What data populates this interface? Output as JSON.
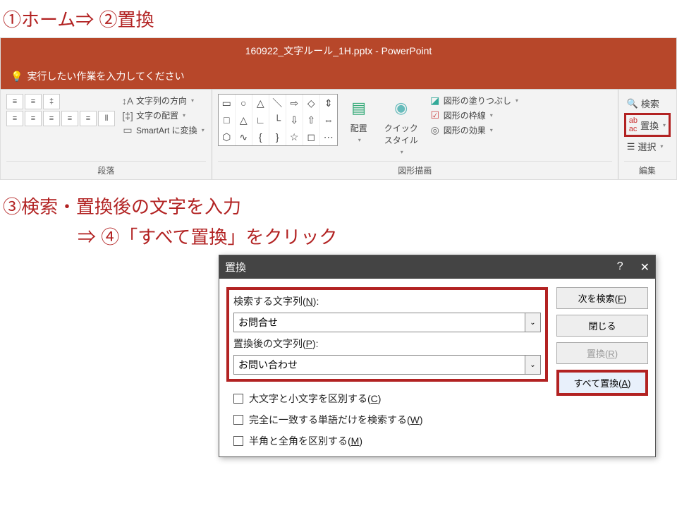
{
  "instructions": {
    "step12": "①ホーム⇒ ②置換",
    "step3": "③検索・置換後の文字を入力",
    "step4": "⇒ ④「すべて置換」をクリック"
  },
  "titlebar": "160922_文字ルール_1H.pptx - PowerPoint",
  "tellme": "実行したい作業を入力してください",
  "ribbon": {
    "paragraph": {
      "label": "段落",
      "textdir": "文字列の方向",
      "textalign": "文字の配置",
      "smartart": "SmartArt に変換"
    },
    "drawing": {
      "label": "図形描画",
      "arrange": "配置",
      "quickstyle": "クイック\nスタイル",
      "fill": "図形の塗りつぶし",
      "outline": "図形の枠線",
      "effects": "図形の効果"
    },
    "editing": {
      "label": "編集",
      "find": "検索",
      "replace": "置換",
      "select": "選択"
    }
  },
  "dialog": {
    "title": "置換",
    "find_label": "検索する文字列(",
    "find_key": "N",
    "find_value": "お問合せ",
    "replace_label": "置換後の文字列(",
    "replace_key": "P",
    "replace_value": "お問い合わせ",
    "chk_case": "大文字と小文字を区別する(",
    "chk_case_key": "C",
    "chk_word": "完全に一致する単語だけを検索する(",
    "chk_word_key": "W",
    "chk_width": "半角と全角を区別する(",
    "chk_width_key": "M",
    "btn_findnext": "次を検索(",
    "btn_findnext_key": "F",
    "btn_close": "閉じる",
    "btn_replace": "置換(",
    "btn_replace_key": "R",
    "btn_replaceall": "すべて置換(",
    "btn_replaceall_key": "A"
  }
}
